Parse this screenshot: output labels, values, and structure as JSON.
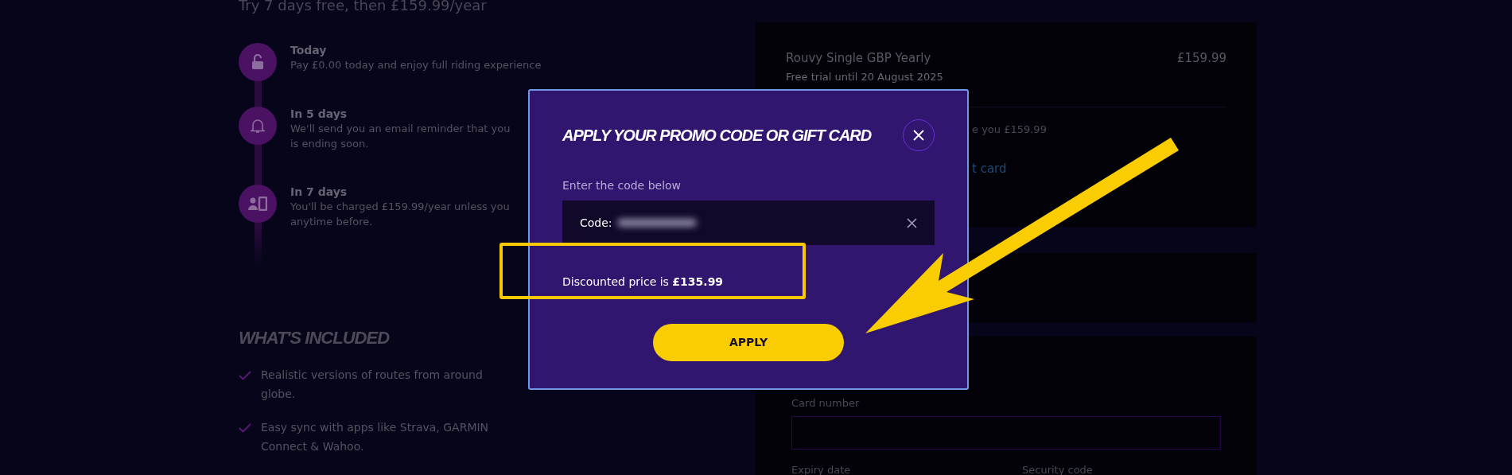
{
  "header": {
    "subtitle": "Try 7 days free, then £159.99/year"
  },
  "timeline": [
    {
      "kind": "lock",
      "title": "Today",
      "lines": [
        "Pay £0.00 today and enjoy full riding experience"
      ]
    },
    {
      "kind": "bell",
      "title": "In 5 days",
      "lines": [
        "We'll send you an email reminder that you",
        "is ending soon."
      ]
    },
    {
      "kind": "card",
      "title": "In 7 days",
      "lines": [
        "You'll be charged £159.99/year unless you",
        "anytime before."
      ]
    }
  ],
  "included": {
    "title": "WHAT'S INCLUDED",
    "items": [
      {
        "lines": [
          "Realistic versions of routes from around",
          "globe."
        ]
      },
      {
        "lines": [
          "Easy sync with apps like Strava, GARMIN",
          "Connect & Wahoo."
        ]
      }
    ]
  },
  "summary": {
    "product": "Rouvy Single GBP Yearly",
    "price": "£159.99",
    "trial": "Free trial until 20 August 2025",
    "charge_note": "e you £159.99",
    "link": "t card"
  },
  "payment": {
    "card_label": "Card number",
    "expiry_label": "Expiry date",
    "security_label": "Security code"
  },
  "modal": {
    "title": "APPLY YOUR PROMO CODE OR GIFT CARD",
    "prompt": "Enter the code below",
    "code_label": "Code:",
    "result": "Discounted price is **£135.99**",
    "apply": "APPLY"
  }
}
